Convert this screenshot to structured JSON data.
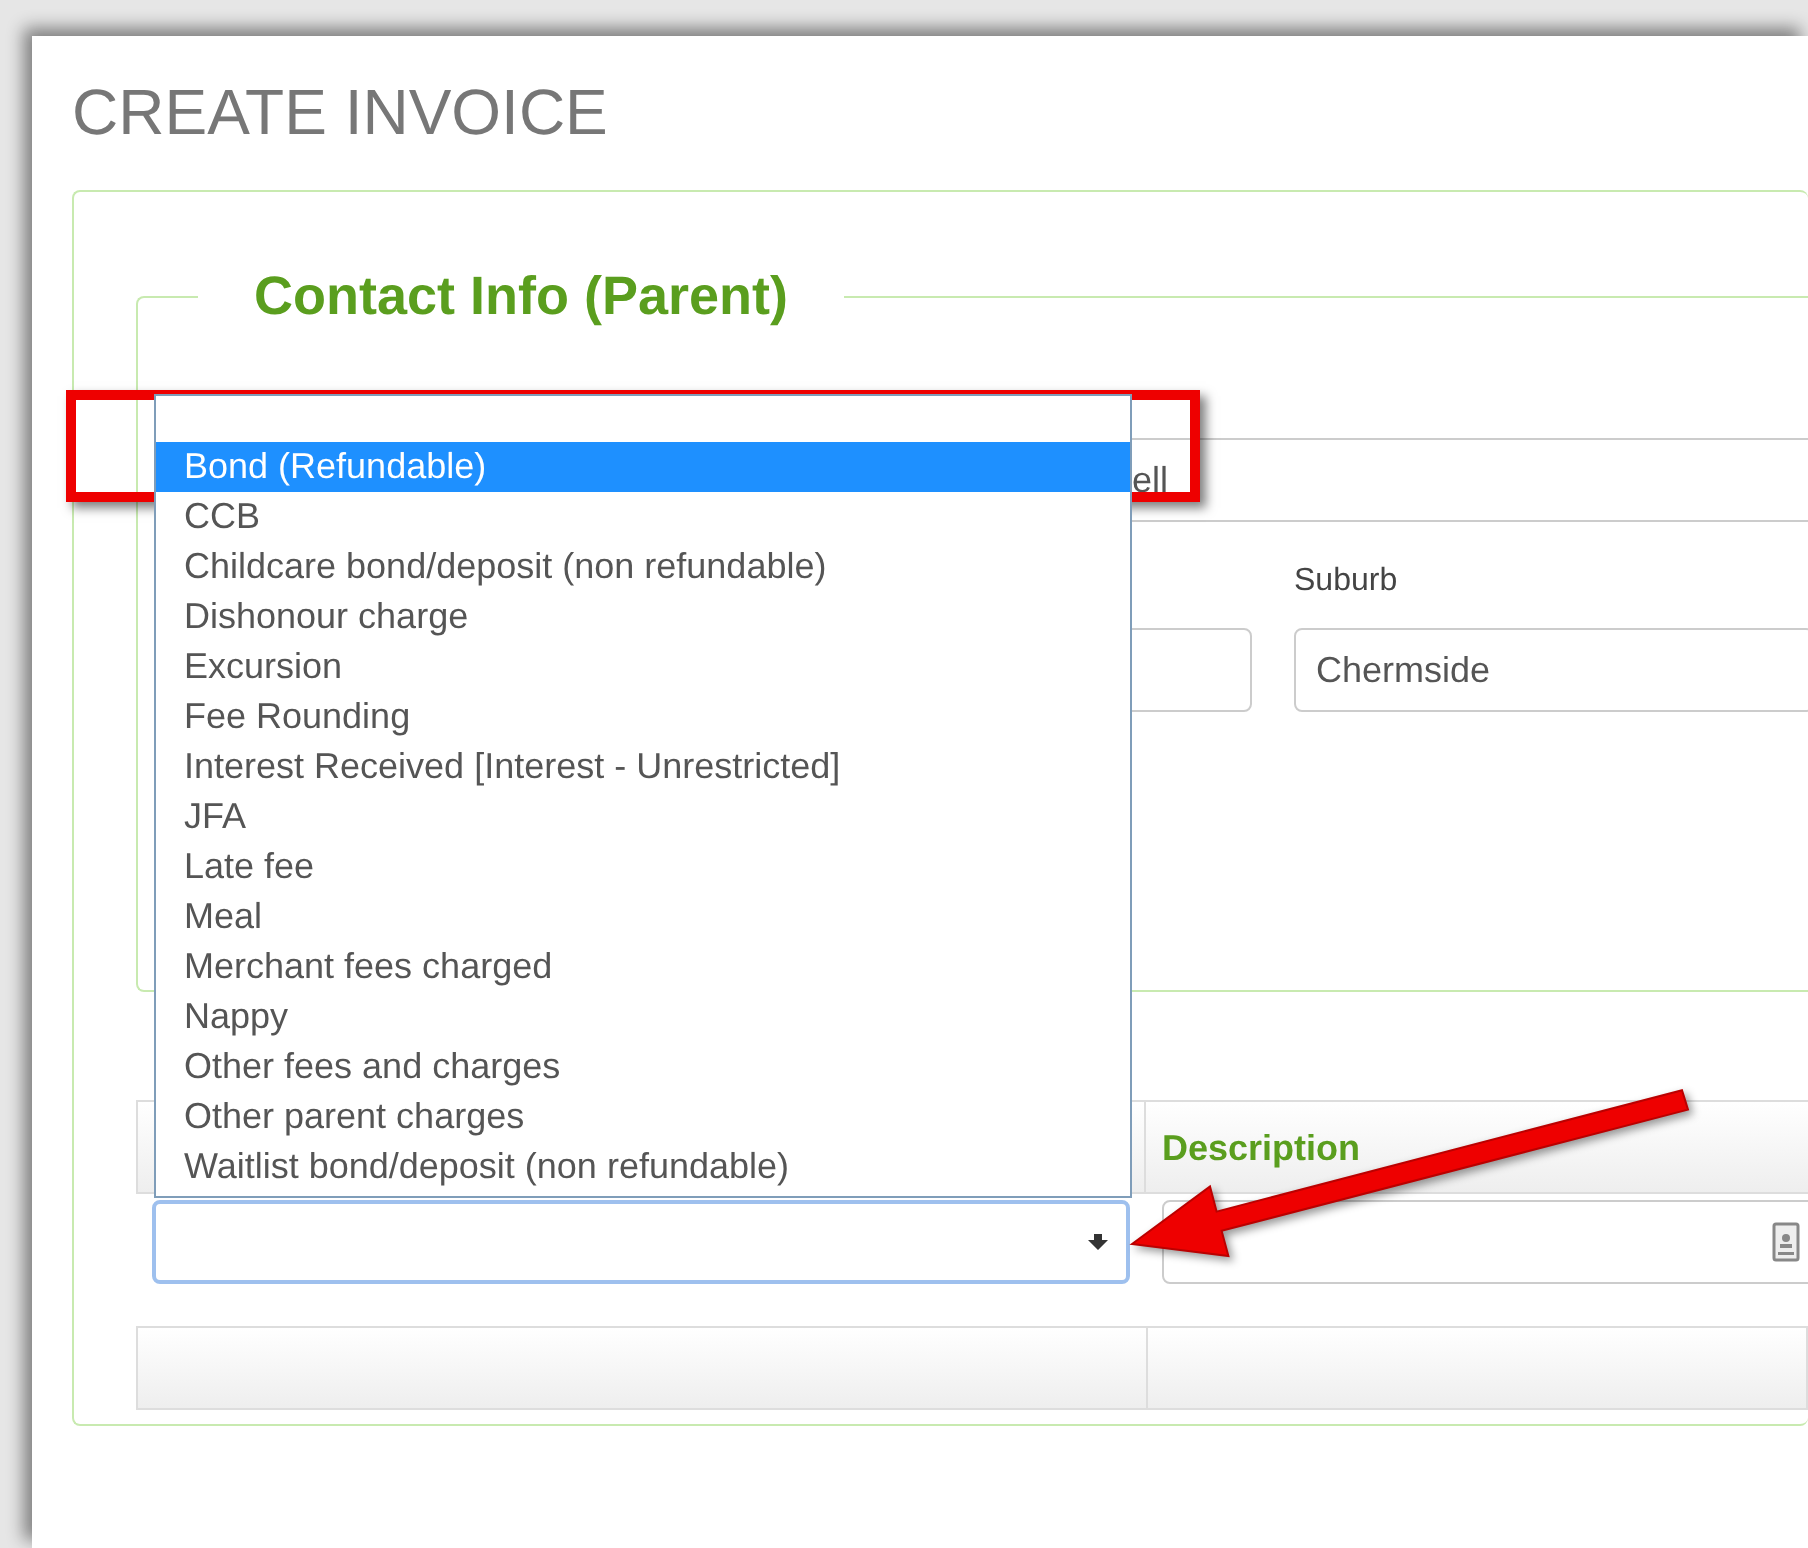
{
  "page": {
    "title": "CREATE INVOICE"
  },
  "contact": {
    "legend": "Contact Info (Parent)",
    "surname_value": "ell",
    "suburb_label": "Suburb",
    "suburb_value": "Chermside"
  },
  "line_items": {
    "description_header": "Description"
  },
  "dropdown": {
    "options": [
      {
        "label": "Bond (Refundable)",
        "selected": true
      },
      {
        "label": "CCB",
        "selected": false
      },
      {
        "label": "Childcare bond/deposit (non refundable)",
        "selected": false
      },
      {
        "label": "Dishonour charge",
        "selected": false
      },
      {
        "label": "Excursion",
        "selected": false
      },
      {
        "label": "Fee Rounding",
        "selected": false
      },
      {
        "label": "Interest Received [Interest - Unrestricted]",
        "selected": false
      },
      {
        "label": "JFA",
        "selected": false
      },
      {
        "label": "Late fee",
        "selected": false
      },
      {
        "label": "Meal",
        "selected": false
      },
      {
        "label": "Merchant fees charged",
        "selected": false
      },
      {
        "label": "Nappy",
        "selected": false
      },
      {
        "label": "Other fees and charges",
        "selected": false
      },
      {
        "label": "Other parent charges",
        "selected": false
      },
      {
        "label": "Waitlist bond/deposit (non refundable)",
        "selected": false
      }
    ]
  }
}
